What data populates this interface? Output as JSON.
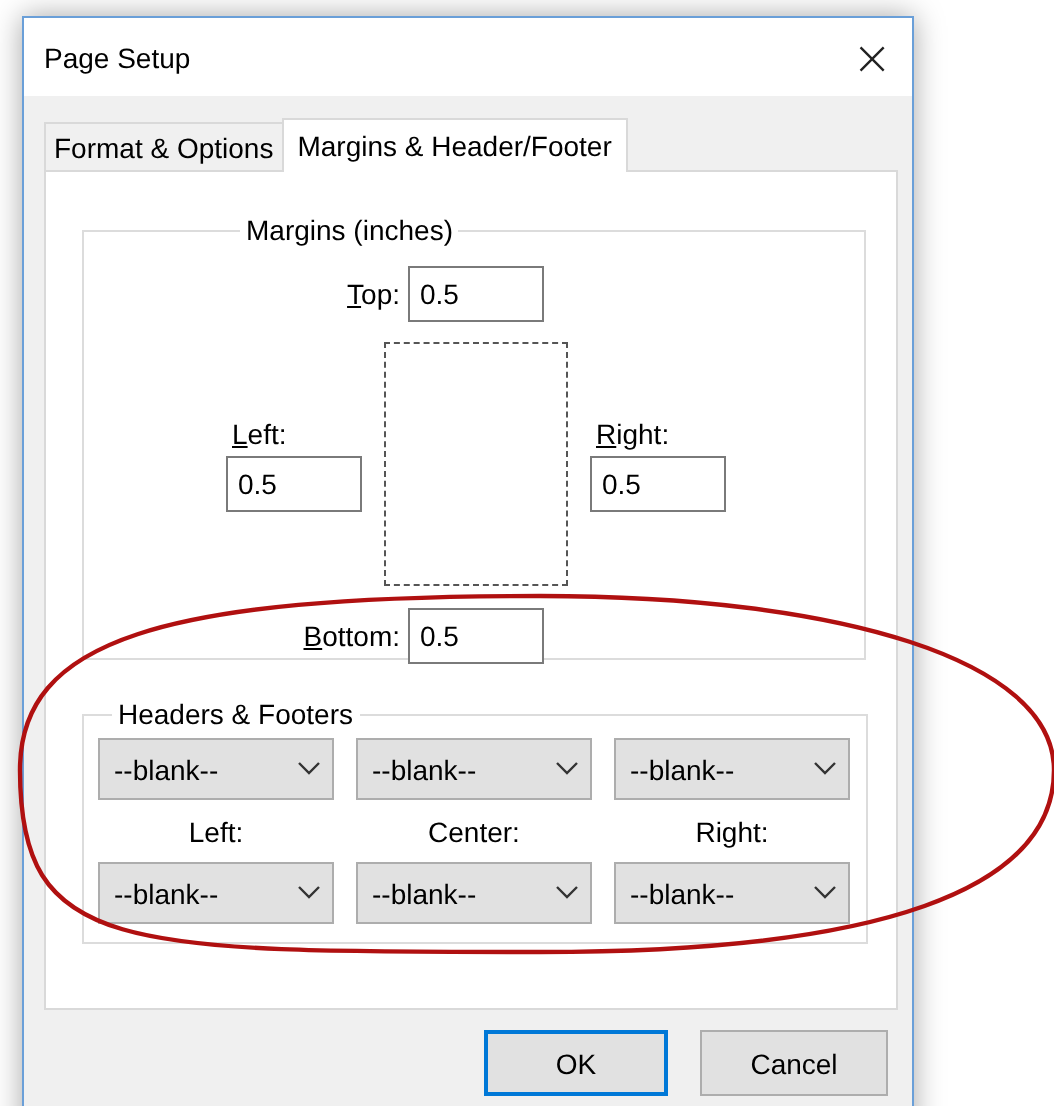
{
  "window": {
    "title": "Page Setup",
    "close": "×"
  },
  "tabs": [
    {
      "label": "Format & Options",
      "selected": false
    },
    {
      "label": "Margins & Header/Footer",
      "selected": true
    }
  ],
  "margins": {
    "title": "Margins (inches)",
    "top": {
      "label": "Top:",
      "value": "0.5"
    },
    "left": {
      "label": "Left:",
      "value": "0.5"
    },
    "right": {
      "label": "Right:",
      "value": "0.5"
    },
    "bottom": {
      "label": "Bottom:",
      "value": "0.5"
    }
  },
  "headers_footers": {
    "title": "Headers & Footers",
    "header_row": [
      "--blank--",
      "--blank--",
      "--blank--"
    ],
    "labels": [
      "Left:",
      "Center:",
      "Right:"
    ],
    "footer_row": [
      "--blank--",
      "--blank--",
      "--blank--"
    ]
  },
  "buttons": [
    {
      "label": "OK",
      "default": true
    },
    {
      "label": "Cancel",
      "default": false
    }
  ],
  "annotation": {
    "kind": "ellipse"
  }
}
